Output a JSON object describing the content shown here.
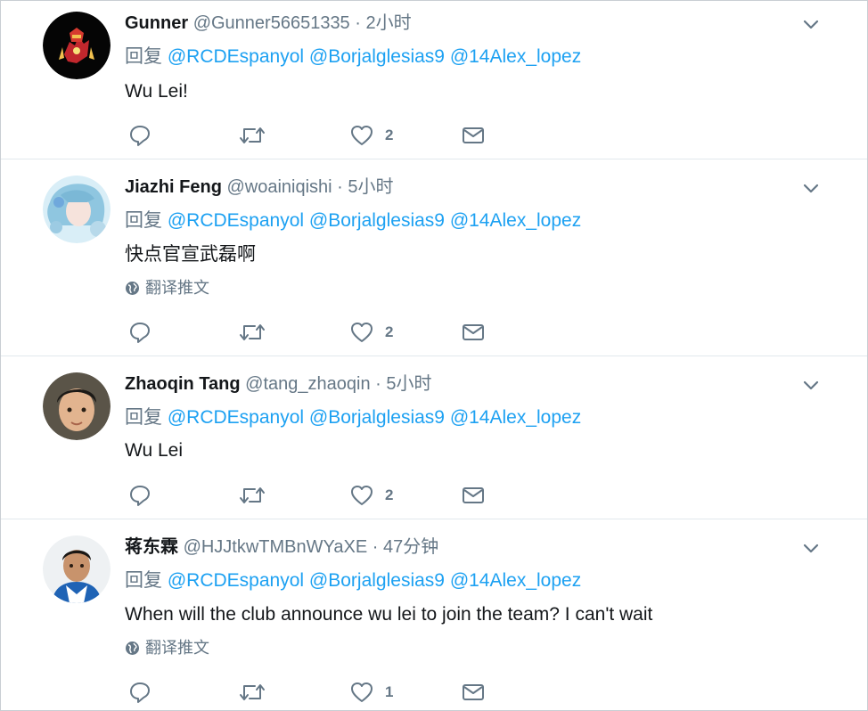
{
  "reply_prefix": "回复",
  "mentions": [
    "@RCDEspanyol",
    "@Borjalglesias9",
    "@14Alex_lopez"
  ],
  "translate_label": "翻译推文",
  "separator": "·",
  "tweets": [
    {
      "name": "Gunner",
      "handle": "@Gunner56651335",
      "time": "2小时",
      "text": "Wu Lei!",
      "likes": "2",
      "avatar": "iron-man-avatar"
    },
    {
      "name": "Jiazhi Feng",
      "handle": "@woainiqishi",
      "time": "5小时",
      "text": "快点官宣武磊啊",
      "likes": "2",
      "avatar": "anime-avatar"
    },
    {
      "name": "Zhaoqin Tang",
      "handle": "@tang_zhaoqin",
      "time": "5小时",
      "text": "Wu Lei",
      "likes": "2",
      "avatar": "boy-avatar"
    },
    {
      "name": "蒋东霖",
      "handle": "@HJJtkwTMBnWYaXE",
      "time": "47分钟",
      "text": "When will the club announce wu lei to join the team? I can't wait",
      "likes": "1",
      "avatar": "player-avatar"
    }
  ]
}
